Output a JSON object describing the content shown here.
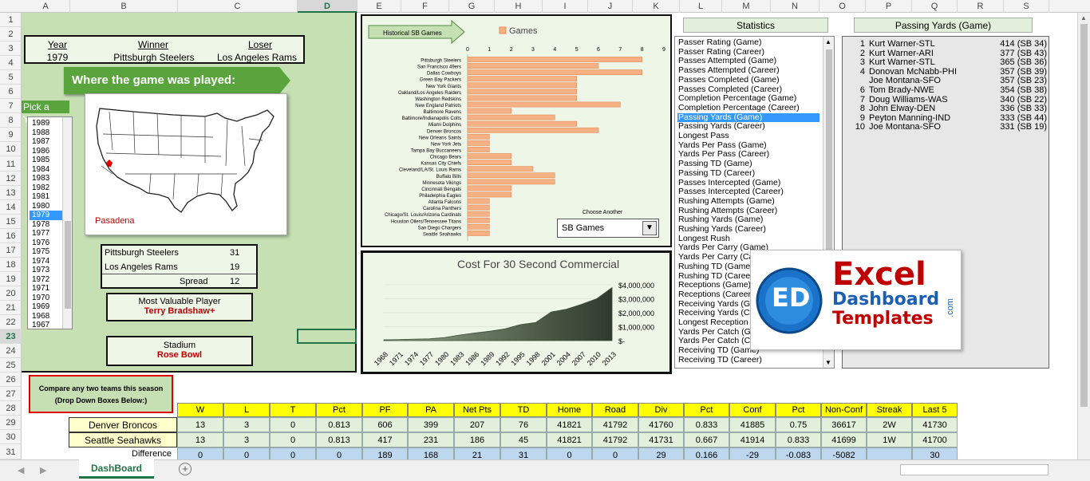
{
  "columns": [
    "A",
    "B",
    "C",
    "D",
    "E",
    "F",
    "G",
    "H",
    "I",
    "J",
    "K",
    "L",
    "M",
    "N",
    "O",
    "P",
    "Q",
    "R",
    "S"
  ],
  "selected_column": "D",
  "rows": [
    "1",
    "2",
    "3",
    "4",
    "5",
    "6",
    "7",
    "8",
    "9",
    "10",
    "11",
    "12",
    "13",
    "14",
    "15",
    "16",
    "17",
    "18",
    "19",
    "20",
    "21",
    "22",
    "23",
    "24",
    "25",
    "26",
    "27",
    "28",
    "29",
    "30",
    "31"
  ],
  "selected_row": "23",
  "game": {
    "year_label": "Year",
    "winner_label": "Winner",
    "loser_label": "Loser",
    "year": "1979",
    "winner": "Pittsburgh Steelers",
    "loser": "Los Angeles Rams",
    "where_banner": "Where the game was played:",
    "location": "Pasadena",
    "pick_year_label": "Pick a Year",
    "score_winner_team": "Pittsburgh Steelers",
    "score_winner": "31",
    "score_loser_team": "Los Angeles Rams",
    "score_loser": "19",
    "spread_label": "Spread",
    "spread": "12",
    "mvp_label": "Most Valuable Player",
    "mvp": "Terry Bradshaw+",
    "stadium_label": "Stadium",
    "stadium": "Rose Bowl"
  },
  "years": [
    "1989",
    "1988",
    "1987",
    "1986",
    "1985",
    "1984",
    "1983",
    "1982",
    "1981",
    "1980",
    "1979",
    "1978",
    "1977",
    "1976",
    "1975",
    "1974",
    "1973",
    "1972",
    "1971",
    "1970",
    "1969",
    "1968",
    "1967"
  ],
  "selected_year": "1979",
  "colors": {
    "green": "#5aa43e",
    "panel": "#eef6e8",
    "bar": "#f4b183",
    "bar_border": "#e8865a",
    "highlight": "#3399ff"
  },
  "chart_data": [
    {
      "type": "bar",
      "orientation": "horizontal",
      "title": "",
      "tag_label": "Historical SB Games",
      "series": [
        {
          "name": "Games"
        }
      ],
      "categories": [
        "Pittsburgh Steelers",
        "San Francisco 49ers",
        "Dallas Cowboys",
        "Green Bay Packers",
        "New York Giants",
        "Oakland/Los Angeles Raiders",
        "Washington Redskins",
        "New England Patriots",
        "Baltimore Ravens",
        "Baltimore/Indianapolis Colts",
        "Miami Dolphins",
        "Denver Broncos",
        "New Orleans Saints",
        "New York Jets",
        "Tampa Bay Buccaneers",
        "Chicago Bears",
        "Kansas City Chiefs",
        "Cleveland/LA/St. Louis Rams",
        "Buffalo Bills",
        "Minnesota Vikings",
        "Cincinnati Bengals",
        "Philadelphia Eagles",
        "Atlanta Falcons",
        "Carolina Panthers",
        "Chicago/St. Louis/Arizona Cardinals",
        "Houston Oilers/Tennessee Titans",
        "San Diego Chargers",
        "Seattle Seahawks"
      ],
      "values": [
        8,
        6,
        8,
        5,
        5,
        5,
        5,
        7,
        2,
        4,
        5,
        6,
        1,
        1,
        1,
        2,
        2,
        3,
        4,
        4,
        2,
        2,
        1,
        1,
        1,
        1,
        1,
        1
      ],
      "xlim": [
        0,
        9
      ],
      "xticks": [
        "0",
        "1",
        "2",
        "3",
        "4",
        "5",
        "6",
        "7",
        "8",
        "9"
      ],
      "dropdown_label": "Choose Another",
      "dropdown_value": "SB Games"
    },
    {
      "type": "area",
      "title": "Cost For 30 Second Commercial",
      "x": [
        "1968",
        "1971",
        "1974",
        "1977",
        "1980",
        "1983",
        "1986",
        "1989",
        "1992",
        "1995",
        "1998",
        "2001",
        "2004",
        "2007",
        "2010",
        "2013"
      ],
      "values": [
        54000,
        72000,
        107000,
        125000,
        222000,
        400000,
        550000,
        675000,
        850000,
        1150000,
        1300000,
        2050000,
        2250000,
        2600000,
        3000000,
        3800000
      ],
      "yticks": [
        "$4,000,000",
        "$3,000,000",
        "$2,000,000",
        "$1,000,000",
        "$-"
      ],
      "ylim": [
        0,
        4000000
      ]
    }
  ],
  "stats": {
    "header": "Statistics",
    "items": [
      "Passer Rating (Game)",
      "Passer Rating (Career)",
      "Passes Attempted (Game)",
      "Passes Attempted (Career)",
      "Passes Completed (Game)",
      "Passes Completed (Career)",
      "Completion Percentage (Game)",
      "Completion Percentage (Career)",
      "Passing Yards (Game)",
      "Passing Yards (Career)",
      "Longest Pass",
      "Yards Per Pass (Game)",
      "Yards Per Pass (Career)",
      "Passing TD (Game)",
      "Passing TD (Career)",
      "Passes Intercepted (Game)",
      "Passes Intercepted (Career)",
      "Rushing Attempts (Game)",
      "Rushing Attempts (Career)",
      "Rushing Yards (Game)",
      "Rushing Yards (Career)",
      "Longest Rush",
      "Yards Per Carry (Game)",
      "Yards Per Carry (Career)",
      "Rushing TD (Game)",
      "Rushing TD (Career)",
      "Receptions (Game)",
      "Receptions (Career)",
      "Receiving Yards (Game)",
      "Receiving Yards (Career)",
      "Longest Reception",
      "Yards Per Catch (Game)",
      "Yards Per Catch (Career)",
      "Receiving TD (Game)",
      "Receiving TD (Career)"
    ],
    "selected": "Passing Yards (Game)"
  },
  "passing": {
    "header": "Passing Yards (Game)",
    "rows": [
      {
        "rank": "1",
        "name": "Kurt Warner-STL",
        "value": "414  (SB 34)"
      },
      {
        "rank": "2",
        "name": "Kurt Warner-ARI",
        "value": "377  (SB 43)"
      },
      {
        "rank": "3",
        "name": "Kurt Warner-STL",
        "value": "365  (SB 36)"
      },
      {
        "rank": "4",
        "name": "Donovan McNabb-PHI",
        "value": "357  (SB 39)"
      },
      {
        "rank": "",
        "name": "Joe Montana-SFO",
        "value": "357  (SB 23)"
      },
      {
        "rank": "6",
        "name": "Tom Brady-NWE",
        "value": "354  (SB 38)"
      },
      {
        "rank": "7",
        "name": "Doug Williams-WAS",
        "value": "340  (SB 22)"
      },
      {
        "rank": "8",
        "name": "John Elway-DEN",
        "value": "336  (SB 33)"
      },
      {
        "rank": "9",
        "name": "Peyton Manning-IND",
        "value": "333  (SB 44)"
      },
      {
        "rank": "10",
        "name": "Joe Montana-SFO",
        "value": "331  (SB 19)"
      }
    ]
  },
  "logo": {
    "line1": "Excel",
    "line2": "Dashboard",
    "line3": "Templates",
    "suffix": ".com",
    "mark": "ED"
  },
  "compare": {
    "note_line1": "Compare any two teams this season",
    "note_line2": "(Drop Down Boxes Below:)",
    "headers": [
      "W",
      "L",
      "T",
      "Pct",
      "PF",
      "PA",
      "Net Pts",
      "TD",
      "Home",
      "Road",
      "Div",
      "Pct",
      "Conf",
      "Pct",
      "Non-Conf",
      "Streak",
      "Last 5"
    ],
    "team1": "Denver Broncos",
    "team1_values": [
      "13",
      "3",
      "0",
      "0.813",
      "606",
      "399",
      "207",
      "76",
      "41821",
      "41792",
      "41760",
      "0.833",
      "41885",
      "0.75",
      "36617",
      "2W",
      "41730"
    ],
    "team2": "Seattle Seahawks",
    "team2_values": [
      "13",
      "3",
      "0",
      "0.813",
      "417",
      "231",
      "186",
      "45",
      "41821",
      "41792",
      "41731",
      "0.667",
      "41914",
      "0.833",
      "41699",
      "1W",
      "41700"
    ],
    "diff_label": "Difference",
    "diff_values": [
      "0",
      "0",
      "0",
      "0",
      "189",
      "168",
      "21",
      "31",
      "0",
      "0",
      "29",
      "0.166",
      "-29",
      "-0.083",
      "-5082",
      "",
      "30"
    ]
  },
  "sheet_tab": "DashBoard"
}
